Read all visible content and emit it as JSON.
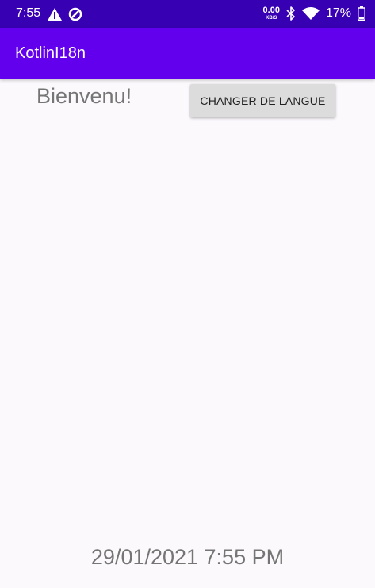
{
  "status_bar": {
    "time": "7:55",
    "net_speed_value": "0.00",
    "net_speed_unit": "KB/S",
    "battery_percent": "17%",
    "icons": [
      "warning-icon",
      "data-saver-icon",
      "bluetooth-icon",
      "wifi-icon",
      "battery-icon"
    ]
  },
  "app_bar": {
    "title": "KotlinI18n"
  },
  "main": {
    "welcome_text": "Bienvenu!",
    "change_language_button": "CHANGER DE LANGUE",
    "datetime": "29/01/2021 7:55 PM"
  },
  "colors": {
    "status_bar": "#3700b3",
    "app_bar": "#6200ee",
    "background": "#fbf9fc",
    "button": "#dcdcdc",
    "text_gray": "#757575"
  }
}
